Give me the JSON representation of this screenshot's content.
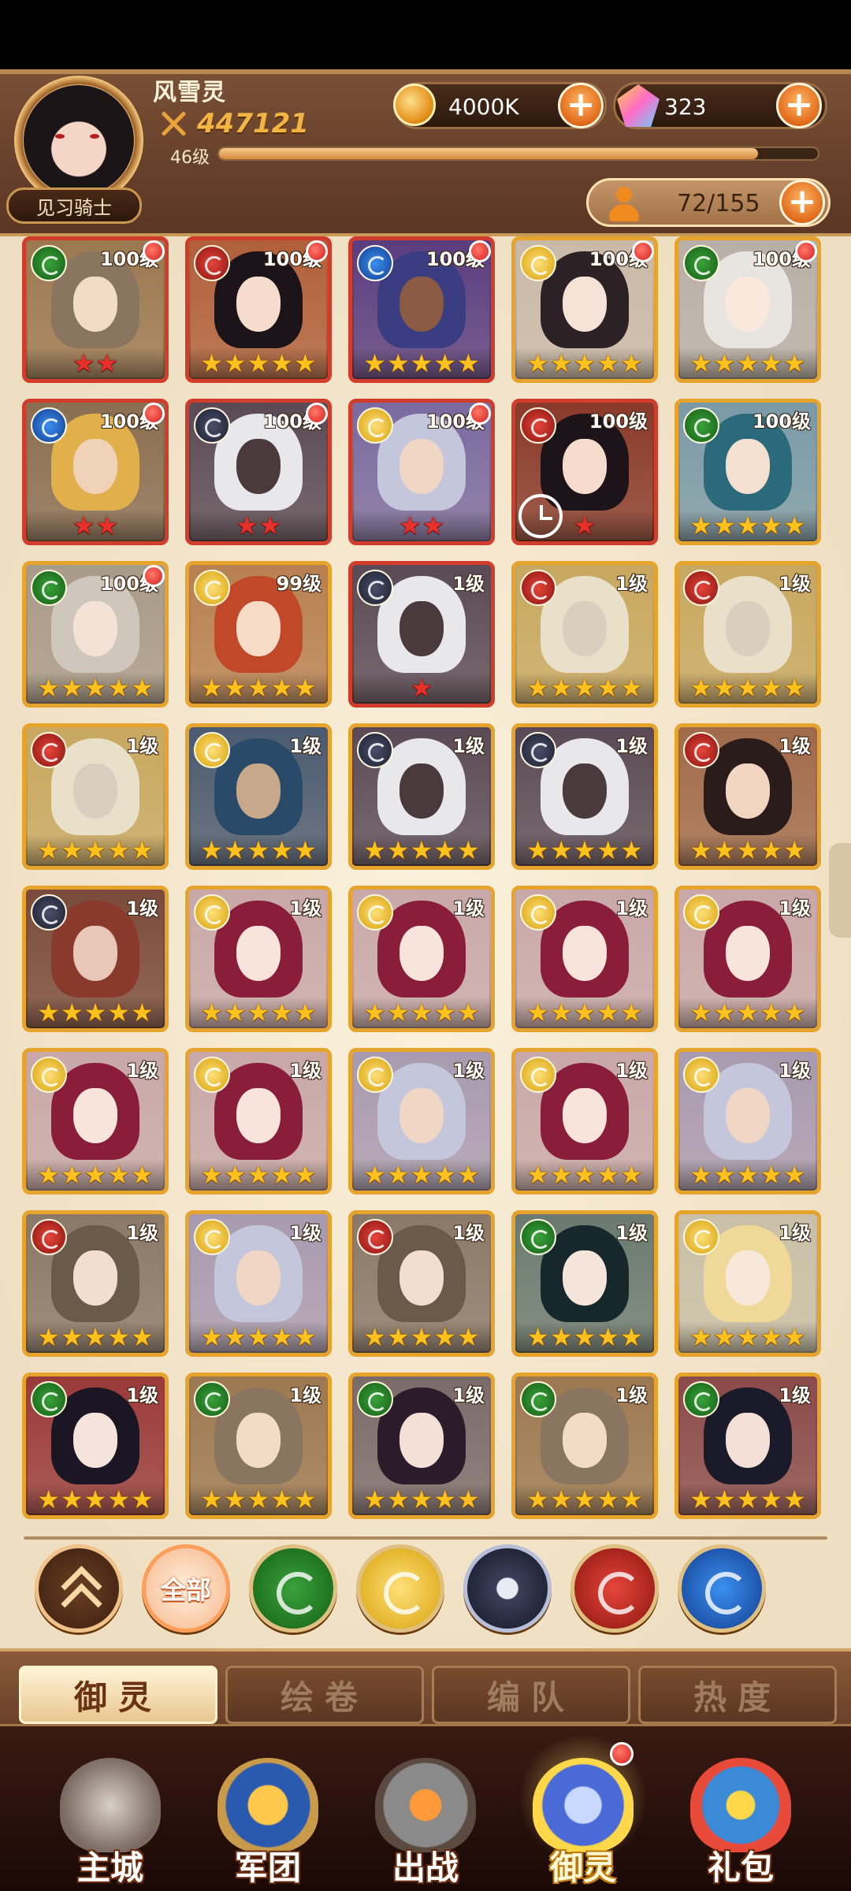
{
  "player": {
    "name": "风雪灵",
    "power": "447121",
    "level": "46级",
    "xp_fraction": 0.9,
    "rank": "见习骑士"
  },
  "currencies": {
    "gold": "4000K",
    "gems": "323"
  },
  "capacity": "72/155",
  "heroes": [
    {
      "level": "100级",
      "faction": "nature",
      "stars": 2,
      "star_color": "red",
      "frame": "rare",
      "dot": true,
      "hair": "#8a7560",
      "skin": "#f2dcc8",
      "bg": "#9c7850"
    },
    {
      "level": "100级",
      "faction": "fire",
      "stars": 5,
      "star_color": "gold",
      "frame": "rare",
      "dot": true,
      "hair": "#1c1418",
      "skin": "#f6dccc",
      "bg": "#b0603a"
    },
    {
      "level": "100级",
      "faction": "water",
      "stars": 5,
      "star_color": "gold",
      "frame": "rare",
      "dot": true,
      "hair": "#3b3d82",
      "skin": "#8a5a42",
      "bg": "#5a3d80"
    },
    {
      "level": "100级",
      "faction": "light",
      "stars": 5,
      "star_color": "gold",
      "frame": "gold",
      "dot": true,
      "hair": "#2c2226",
      "skin": "#f6e2d6",
      "bg": "#c9b9a8"
    },
    {
      "level": "100级",
      "faction": "nature",
      "stars": 5,
      "star_color": "gold",
      "frame": "gold",
      "dot": true,
      "hair": "#e8e4e0",
      "skin": "#fae8dc",
      "bg": "#b8b0a8"
    },
    {
      "level": "100级",
      "faction": "water",
      "stars": 2,
      "star_color": "red",
      "frame": "rare",
      "dot": true,
      "hair": "#e2b04a",
      "skin": "#f0d2b8",
      "bg": "#8a6e52"
    },
    {
      "level": "100级",
      "faction": "dark",
      "stars": 2,
      "star_color": "red",
      "frame": "rare",
      "dot": true,
      "hair": "#e8e8ea",
      "skin": "#4a3a3e",
      "bg": "#5a4a56"
    },
    {
      "level": "100级",
      "faction": "light",
      "stars": 2,
      "star_color": "red",
      "frame": "rare",
      "dot": true,
      "hair": "#c4c6dc",
      "skin": "#f0d6c4",
      "bg": "#7a6aa0"
    },
    {
      "level": "100级",
      "faction": "fire",
      "stars": 1,
      "star_color": "red",
      "frame": "rare",
      "dot": false,
      "timer": true,
      "hair": "#1c1418",
      "skin": "#f6dccc",
      "bg": "#8a3a2a"
    },
    {
      "level": "100级",
      "faction": "nature",
      "stars": 5,
      "star_color": "gold",
      "frame": "gold",
      "dot": false,
      "hair": "#2a6a7a",
      "skin": "#f4e0d0",
      "bg": "#7a9aa8"
    },
    {
      "level": "100级",
      "faction": "nature",
      "stars": 5,
      "star_color": "gold",
      "frame": "gold",
      "dot": true,
      "hair": "#cfc6bc",
      "skin": "#f4e2d6",
      "bg": "#a89a88"
    },
    {
      "level": "99级",
      "faction": "light",
      "stars": 5,
      "star_color": "gold",
      "frame": "gold",
      "dot": false,
      "hair": "#c2482a",
      "skin": "#f6dcc8",
      "bg": "#b88050"
    },
    {
      "level": "1级",
      "faction": "dark",
      "stars": 1,
      "star_color": "red",
      "frame": "rare",
      "dot": false,
      "hair": "#e8e8ea",
      "skin": "#4a3a3e",
      "bg": "#5a4a56"
    },
    {
      "level": "1级",
      "faction": "fire",
      "stars": 5,
      "star_color": "gold",
      "frame": "gold",
      "dot": false,
      "hair": "#e8e0c8",
      "skin": "#d8cfc0",
      "bg": "#c8a860"
    },
    {
      "level": "1级",
      "faction": "fire",
      "stars": 5,
      "star_color": "gold",
      "frame": "gold",
      "dot": false,
      "hair": "#e8e0c8",
      "skin": "#d8cfc0",
      "bg": "#c8a860"
    },
    {
      "level": "1级",
      "faction": "fire",
      "stars": 5,
      "star_color": "gold",
      "frame": "gold",
      "dot": false,
      "hair": "#e8e0c8",
      "skin": "#d8cfc0",
      "bg": "#c8a860"
    },
    {
      "level": "1级",
      "faction": "light",
      "stars": 5,
      "star_color": "gold",
      "frame": "gold",
      "dot": false,
      "hair": "#2a4a6a",
      "skin": "#c8a88a",
      "bg": "#4a5a70"
    },
    {
      "level": "1级",
      "faction": "dark",
      "stars": 5,
      "star_color": "gold",
      "frame": "gold",
      "dot": false,
      "hair": "#e8e8ea",
      "skin": "#4a3a3e",
      "bg": "#5a4a56"
    },
    {
      "level": "1级",
      "faction": "dark",
      "stars": 5,
      "star_color": "gold",
      "frame": "gold",
      "dot": false,
      "hair": "#e8e8ea",
      "skin": "#4a3a3e",
      "bg": "#5a4a56"
    },
    {
      "level": "1级",
      "faction": "fire",
      "stars": 5,
      "star_color": "gold",
      "frame": "gold",
      "dot": false,
      "hair": "#2a1c1a",
      "skin": "#f2d6c2",
      "bg": "#a06a4a"
    },
    {
      "level": "1级",
      "faction": "dark",
      "stars": 5,
      "star_color": "gold",
      "frame": "gold",
      "dot": false,
      "hair": "#8a3a2a",
      "skin": "#e8c6b8",
      "bg": "#7a4a3a"
    },
    {
      "level": "1级",
      "faction": "light",
      "stars": 5,
      "star_color": "gold",
      "frame": "gold",
      "dot": false,
      "hair": "#8a1e3a",
      "skin": "#f8e4da",
      "bg": "#c8a8a8"
    },
    {
      "level": "1级",
      "faction": "light",
      "stars": 5,
      "star_color": "gold",
      "frame": "gold",
      "dot": false,
      "hair": "#8a1e3a",
      "skin": "#f8e4da",
      "bg": "#c8a8a8"
    },
    {
      "level": "1级",
      "faction": "light",
      "stars": 5,
      "star_color": "gold",
      "frame": "gold",
      "dot": false,
      "hair": "#8a1e3a",
      "skin": "#f8e4da",
      "bg": "#c8a8a8"
    },
    {
      "level": "1级",
      "faction": "light",
      "stars": 5,
      "star_color": "gold",
      "frame": "gold",
      "dot": false,
      "hair": "#8a1e3a",
      "skin": "#f8e4da",
      "bg": "#c8a8a8"
    },
    {
      "level": "1级",
      "faction": "light",
      "stars": 5,
      "star_color": "gold",
      "frame": "gold",
      "dot": false,
      "hair": "#8a1e3a",
      "skin": "#f8e4da",
      "bg": "#c8a8a8"
    },
    {
      "level": "1级",
      "faction": "light",
      "stars": 5,
      "star_color": "gold",
      "frame": "gold",
      "dot": false,
      "hair": "#8a1e3a",
      "skin": "#f8e4da",
      "bg": "#c8a8a8"
    },
    {
      "level": "1级",
      "faction": "light",
      "stars": 5,
      "star_color": "gold",
      "frame": "gold",
      "dot": false,
      "hair": "#c4c6dc",
      "skin": "#f0d6c4",
      "bg": "#a89ab0"
    },
    {
      "level": "1级",
      "faction": "light",
      "stars": 5,
      "star_color": "gold",
      "frame": "gold",
      "dot": false,
      "hair": "#8a1e3a",
      "skin": "#f8e4da",
      "bg": "#c8a8a8"
    },
    {
      "level": "1级",
      "faction": "light",
      "stars": 5,
      "star_color": "gold",
      "frame": "gold",
      "dot": false,
      "hair": "#c4c6dc",
      "skin": "#f0d6c4",
      "bg": "#a89ab0"
    },
    {
      "level": "1级",
      "faction": "fire",
      "stars": 5,
      "star_color": "gold",
      "frame": "gold",
      "dot": false,
      "hair": "#6a5a4a",
      "skin": "#f2ddd0",
      "bg": "#8a7868"
    },
    {
      "level": "1级",
      "faction": "light",
      "stars": 5,
      "star_color": "gold",
      "frame": "gold",
      "dot": false,
      "hair": "#c4c6dc",
      "skin": "#f0d6c4",
      "bg": "#a89ab0"
    },
    {
      "level": "1级",
      "faction": "fire",
      "stars": 5,
      "star_color": "gold",
      "frame": "gold",
      "dot": false,
      "hair": "#6a5a4a",
      "skin": "#f2ddd0",
      "bg": "#8a7868"
    },
    {
      "level": "1级",
      "faction": "nature",
      "stars": 5,
      "star_color": "gold",
      "frame": "gold",
      "dot": false,
      "hair": "#16282c",
      "skin": "#f4e4da",
      "bg": "#6a7a70"
    },
    {
      "level": "1级",
      "faction": "light",
      "stars": 5,
      "star_color": "gold",
      "frame": "gold",
      "dot": false,
      "hair": "#f0d898",
      "skin": "#f8e8dc",
      "bg": "#c8c0a8"
    },
    {
      "level": "1级",
      "faction": "nature",
      "stars": 5,
      "star_color": "gold",
      "frame": "gold",
      "dot": false,
      "hair": "#1a1624",
      "skin": "#f6e4dc",
      "bg": "#9a3a3a"
    },
    {
      "level": "1级",
      "faction": "nature",
      "stars": 5,
      "star_color": "gold",
      "frame": "gold",
      "dot": false,
      "hair": "#8a7560",
      "skin": "#f2dcc8",
      "bg": "#9c7850"
    },
    {
      "level": "1级",
      "faction": "nature",
      "stars": 5,
      "star_color": "gold",
      "frame": "gold",
      "dot": false,
      "hair": "#2a1c2a",
      "skin": "#f4e0d6",
      "bg": "#7a6a6a"
    },
    {
      "level": "1级",
      "faction": "nature",
      "stars": 5,
      "star_color": "gold",
      "frame": "gold",
      "dot": false,
      "hair": "#8a7560",
      "skin": "#f2dcc8",
      "bg": "#9c7850"
    },
    {
      "level": "1级",
      "faction": "nature",
      "stars": 5,
      "star_color": "gold",
      "frame": "gold",
      "dot": false,
      "hair": "#1a1a2a",
      "skin": "#f4e0d6",
      "bg": "#8a4a4a"
    }
  ],
  "filters": {
    "collapse_icon": "double-chevron-up-icon",
    "all_label": "全部",
    "factions": [
      "nature",
      "light",
      "dark",
      "fire",
      "water"
    ]
  },
  "subtabs": [
    "御灵",
    "绘卷",
    "编队",
    "热度"
  ],
  "nav": [
    "主城",
    "军团",
    "出战",
    "御灵",
    "礼包"
  ],
  "colors": {
    "nature": "#2f8f2f",
    "fire": "#c8281e",
    "water": "#2a6cd0",
    "light": "#e8b61c",
    "dark": "#2a2e44"
  }
}
